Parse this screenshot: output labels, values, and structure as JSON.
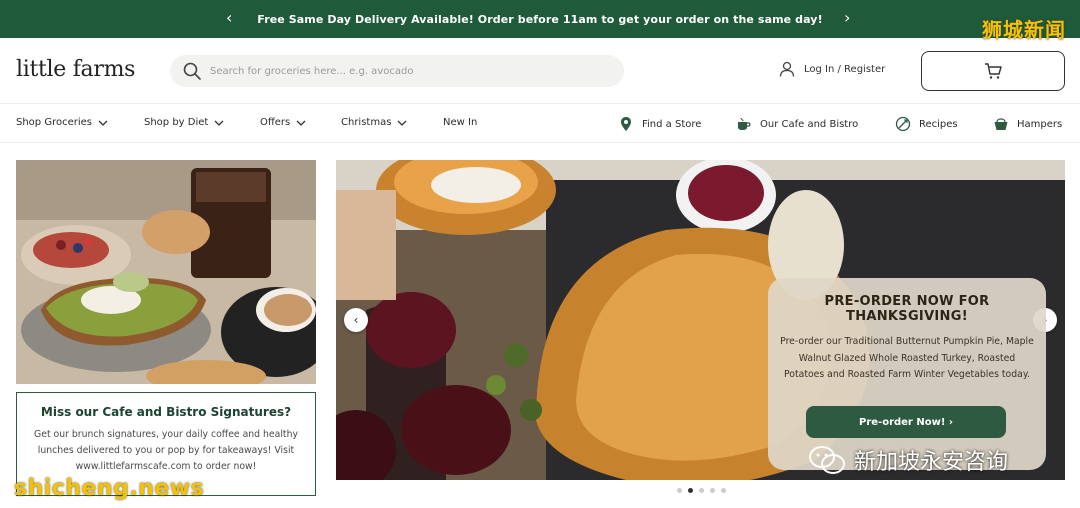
{
  "banner": {
    "message": "Free Same Day Delivery Available! Order before 11am to get your order on the same day!",
    "prev_label": "‹",
    "next_label": "›",
    "watermark": "狮城新闻"
  },
  "header": {
    "logo": "little farms",
    "search_placeholder": "Search for groceries here... e.g. avocado",
    "login_label": "Log In / Register",
    "cart_icon": "cart-icon"
  },
  "nav": {
    "left": [
      {
        "label": "Shop Groceries",
        "dropdown": true
      },
      {
        "label": "Shop by Diet",
        "dropdown": true
      },
      {
        "label": "Offers",
        "dropdown": true
      },
      {
        "label": "Christmas",
        "dropdown": true
      },
      {
        "label": "New In",
        "dropdown": false
      }
    ],
    "right": [
      {
        "label": "Find a Store",
        "icon": "location-pin-icon"
      },
      {
        "label": "Our Cafe and Bistro",
        "icon": "coffee-cup-icon"
      },
      {
        "label": "Recipes",
        "icon": "recipe-icon"
      },
      {
        "label": "Hampers",
        "icon": "hamper-icon"
      }
    ]
  },
  "cafe_card": {
    "title": "Miss our Cafe and Bistro Signatures?",
    "body": "Get our brunch signatures, your daily coffee and healthy lunches delivered to you or pop by for takeaways! Visit www.littlefarmscafe.com to order now!"
  },
  "hero": {
    "title": "PRE-ORDER NOW FOR THANKSGIVING!",
    "body": "Pre-order our Traditional Butternut Pumpkin Pie, Maple Walnut Glazed Whole Roasted Turkey, Roasted Potatoes and Roasted Farm Winter Vegetables today.",
    "button_label": "Pre-order Now! ›",
    "slides": 5,
    "active_slide": 2
  },
  "watermarks": {
    "bottom_left": "shicheng.news",
    "bottom_right": "新加坡永安咨询"
  },
  "colors": {
    "brand_green": "#1f5a3a",
    "button_green": "#2e5a42",
    "watermark_yellow": "#f4c200"
  }
}
